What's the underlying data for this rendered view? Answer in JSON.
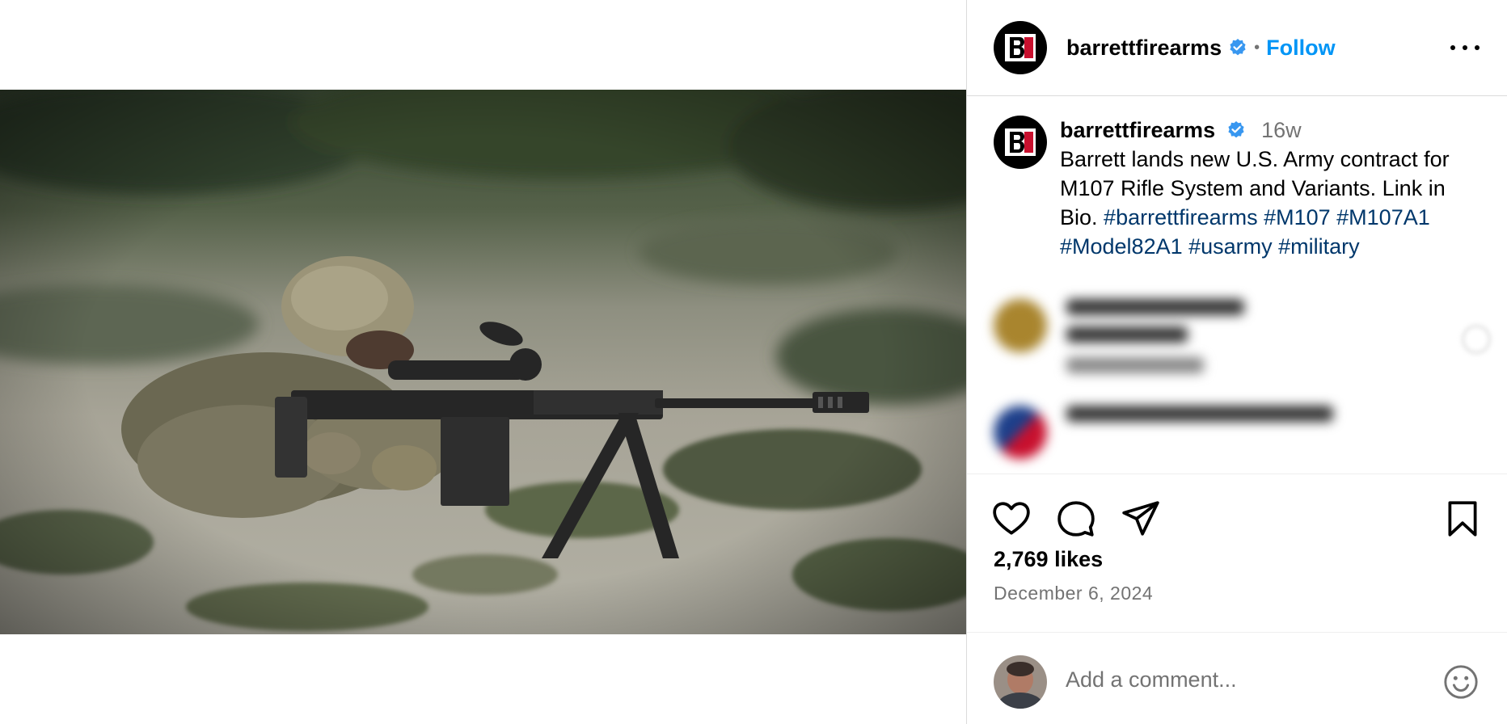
{
  "post": {
    "username": "barrettfirearms",
    "follow_label": "Follow",
    "separator": "•",
    "caption": {
      "time_ago": "16w",
      "line1": "Barrett lands new U.S. Army contract for",
      "line2": "M107 Rifle System and Variants. Link in",
      "line3_text": "Bio.",
      "line3_tags": "#barrettfirearms #M107 #M107A1",
      "line4_tags": "#Model82A1 #usarmy #military"
    },
    "likes": "2,769 likes",
    "date": "December 6, 2024"
  },
  "comment_box": {
    "placeholder": "Add a comment..."
  },
  "icons": {
    "verified": "verified-badge-icon",
    "more": "more-options-icon",
    "like": "heart-icon",
    "comment": "comment-bubble-icon",
    "share": "paper-plane-icon",
    "save": "bookmark-icon",
    "emoji": "smiley-icon"
  },
  "colors": {
    "accent": "#0095f6",
    "hashtag": "#00376b",
    "verified": "#3897f0",
    "muted": "#737373",
    "brand_red": "#c8102e"
  }
}
